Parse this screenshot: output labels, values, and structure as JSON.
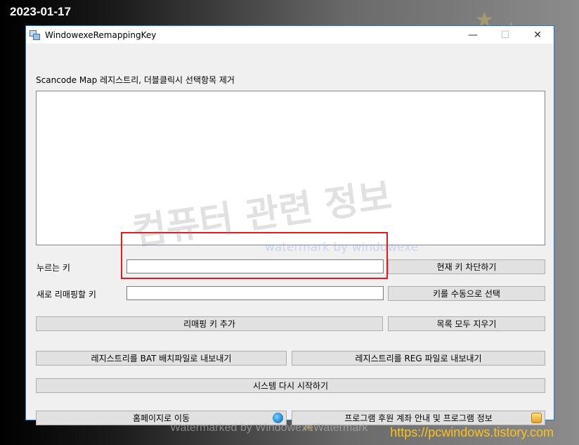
{
  "overlay": {
    "date": "2023-01-17",
    "url": "https://pcwindows.tistory.com"
  },
  "window": {
    "title": "WindowexeRemappingKey",
    "controls": {
      "minimize": "—",
      "maximize": "☐",
      "close": "✕"
    }
  },
  "main": {
    "list_caption": "Scancode Map 레지스트리, 더블클릭시 선택항목 제거",
    "pressed_key_label": "누르는 키",
    "pressed_key_value": "",
    "remap_key_label": "새로 리매핑할 키",
    "remap_key_value": "",
    "buttons": {
      "block_current_key": "현재 키 차단하기",
      "select_key_manually": "키를 수동으로 선택",
      "add_remapping": "리매핑 키 추가",
      "clear_list": "목록 모두 지우기",
      "export_bat": "레지스트리를 BAT 배치파일로 내보내기",
      "export_reg": "레지스트리를 REG 파일로 내보내기",
      "restart_system": "시스템 다시 시작하기",
      "go_homepage": "홈페이지로 이동",
      "donate_info": "프로그램 후원 계좌 안내 및 프로그램 정보"
    }
  },
  "watermarks": {
    "korean": "컴퓨터 관련 정보",
    "english": "watermark by windowexe",
    "bottom": "Watermarked by WindowexeWatermark"
  },
  "colors": {
    "highlight_border": "#e21c1c",
    "url_text": "#ffc21a",
    "window_border": "#1e78d7"
  }
}
